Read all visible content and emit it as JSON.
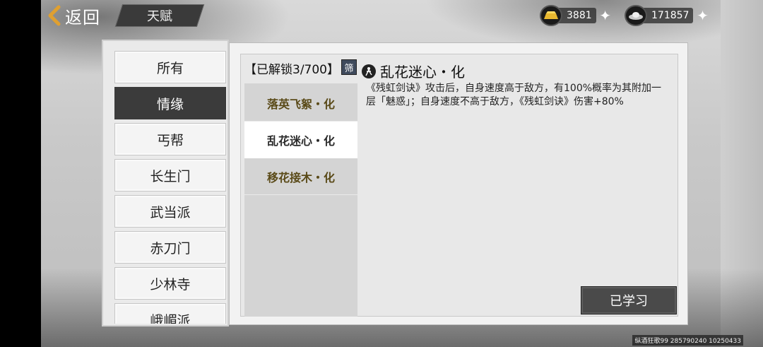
{
  "header": {
    "back_label": "返回",
    "tab_title": "天赋"
  },
  "currency": {
    "gold": {
      "icon": "gold-ingot-icon",
      "value": "3881"
    },
    "silver": {
      "icon": "silver-ingot-icon",
      "value": "171857"
    }
  },
  "categories": [
    {
      "label": "所有",
      "active": false
    },
    {
      "label": "情缘",
      "active": true
    },
    {
      "label": "丐帮",
      "active": false
    },
    {
      "label": "长生门",
      "active": false
    },
    {
      "label": "武当派",
      "active": false
    },
    {
      "label": "赤刀门",
      "active": false
    },
    {
      "label": "少林寺",
      "active": false
    },
    {
      "label": "峨嵋派",
      "active": false
    }
  ],
  "talents": {
    "unlock_label": "【已解锁3/700】",
    "filter_label": "筛",
    "items": [
      {
        "label": "落英飞絮・化",
        "active": false
      },
      {
        "label": "乱花迷心・化",
        "active": true
      },
      {
        "label": "移花接木・化",
        "active": false
      }
    ]
  },
  "detail": {
    "title": "乱花迷心・化",
    "description": "《残虹剑诀》攻击后，自身速度高于敌方，有100%概率为其附加一层「魅惑」；自身速度不高于敌方，《残虹剑诀》伤害+80%"
  },
  "actions": {
    "learned_label": "已学习"
  },
  "footer": {
    "server_info": "纵酒狂歌99 285790240 10250433"
  }
}
